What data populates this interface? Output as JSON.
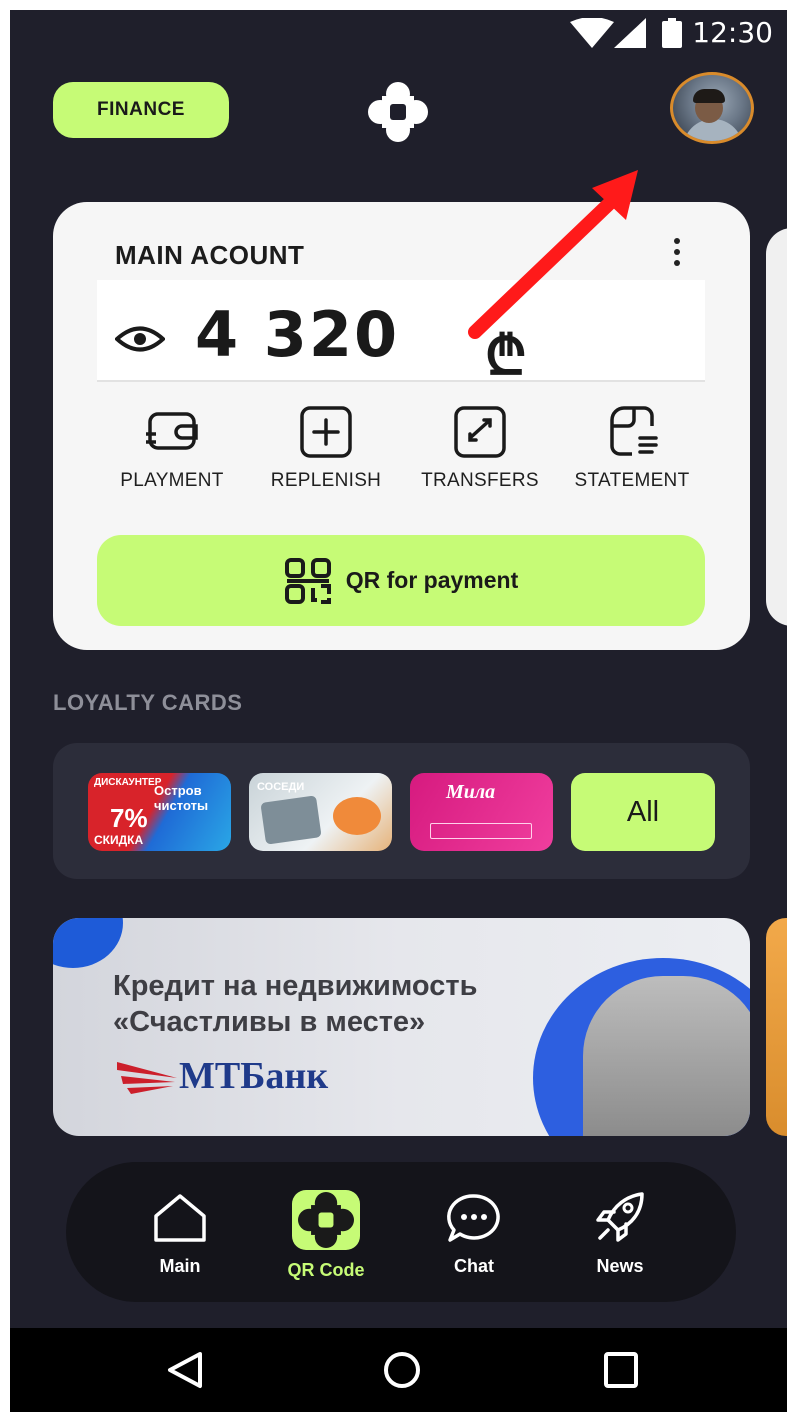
{
  "status_bar": {
    "time": "12:30"
  },
  "header": {
    "finance_label": "FINANCE"
  },
  "account": {
    "title": "MAIN ACOUNT",
    "balance": "4 320",
    "currency_symbol": "₾"
  },
  "actions": [
    {
      "label": "PLAYMENT",
      "icon": "wallet-icon"
    },
    {
      "label": "REPLENISH",
      "icon": "plus-square-icon"
    },
    {
      "label": "TRANSFERS",
      "icon": "transfer-icon"
    },
    {
      "label": "STATEMENT",
      "icon": "statement-icon"
    }
  ],
  "qr_button": {
    "label": "QR for payment"
  },
  "loyalty": {
    "title": "LOYALTY CARDS",
    "cards": [
      {
        "name": "Остров чистоты",
        "top_text": "ДИСКАУНТЕР",
        "discount": "7%",
        "discount_caption": "СКИДКА"
      },
      {
        "name": "Соседи",
        "top_text": "СОСЕДИ"
      },
      {
        "name": "Мила",
        "top_text": "Мила"
      }
    ],
    "all_label": "All"
  },
  "banner": {
    "title_line1": "Кредит на недвижимость",
    "title_line2": "«Счастливы в месте»",
    "bank_name": "МТБанк"
  },
  "bottom_nav": [
    {
      "label": "Main",
      "icon": "home-icon",
      "active": false
    },
    {
      "label": "QR Code",
      "icon": "qr-logo-icon",
      "active": true
    },
    {
      "label": "Chat",
      "icon": "chat-icon",
      "active": false
    },
    {
      "label": "News",
      "icon": "rocket-icon",
      "active": false
    }
  ],
  "colors": {
    "accent": "#c6fb76",
    "background": "#1f1f2b",
    "card": "#f6f6f6",
    "annotation_arrow": "#ff1a1a"
  }
}
